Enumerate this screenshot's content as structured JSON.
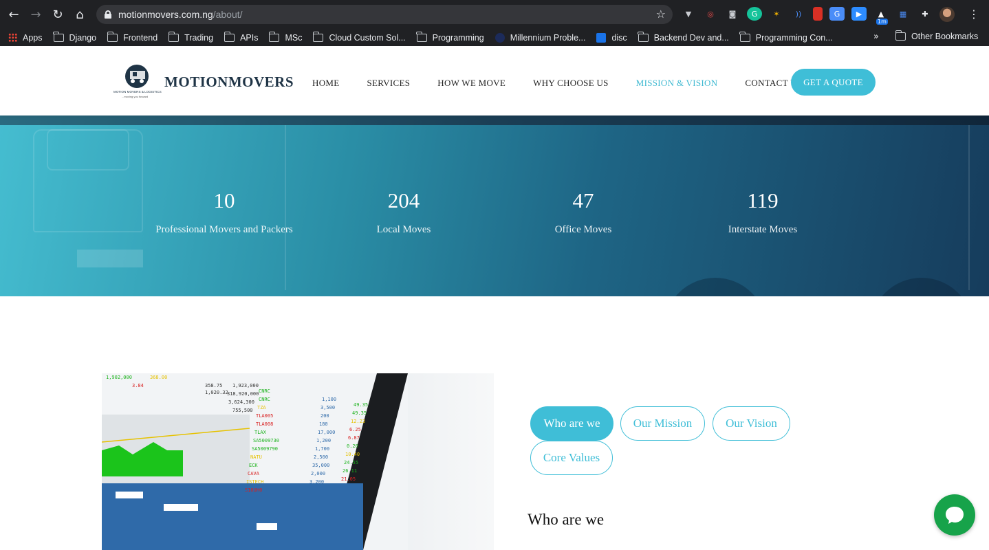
{
  "browser": {
    "url_host": "motionmovers.com.ng",
    "url_path": "/about/",
    "bookmarks": [
      {
        "label": "Apps",
        "kind": "apps"
      },
      {
        "label": "Django",
        "kind": "folder"
      },
      {
        "label": "Frontend",
        "kind": "folder"
      },
      {
        "label": "Trading",
        "kind": "folder"
      },
      {
        "label": "APIs",
        "kind": "folder"
      },
      {
        "label": "MSc",
        "kind": "folder"
      },
      {
        "label": "Cloud Custom Sol...",
        "kind": "folder"
      },
      {
        "label": "Programming",
        "kind": "folder"
      },
      {
        "label": "Millennium Proble...",
        "kind": "site"
      },
      {
        "label": "disc",
        "kind": "flag"
      },
      {
        "label": "Backend Dev and...",
        "kind": "folder"
      },
      {
        "label": "Programming Con...",
        "kind": "folder"
      }
    ],
    "more_bookmarks": "»",
    "other_bookmarks": "Other Bookmarks",
    "extension_badge": "1m"
  },
  "site": {
    "brand": "MOTIONMOVERS",
    "logo_tagline": "MOTION MOVERS & LOGISTICS",
    "logo_subtag": "...moving you forward",
    "nav": [
      {
        "label": "HOME",
        "active": false
      },
      {
        "label": "SERVICES",
        "active": false
      },
      {
        "label": "HOW WE MOVE",
        "active": false
      },
      {
        "label": "WHY CHOOSE US",
        "active": false
      },
      {
        "label": "MISSION & VISION",
        "active": true
      },
      {
        "label": "CONTACT US",
        "active": false
      }
    ],
    "quote_button": "GET A QUOTE",
    "accent_color": "#3fbed7"
  },
  "stats": [
    {
      "value": "10",
      "label": "Professional Movers and Packers"
    },
    {
      "value": "204",
      "label": "Local Moves"
    },
    {
      "value": "47",
      "label": "Office Moves"
    },
    {
      "value": "119",
      "label": "Interstate Moves"
    }
  ],
  "about": {
    "tabs": [
      {
        "label": "Who are we",
        "active": true
      },
      {
        "label": "Our Mission",
        "active": false
      },
      {
        "label": "Our Vision",
        "active": false
      },
      {
        "label": "Core Values",
        "active": false
      }
    ],
    "section_title": "Who are we"
  },
  "chat": {
    "icon": "chat-bubble-icon",
    "color": "#17a34a"
  }
}
